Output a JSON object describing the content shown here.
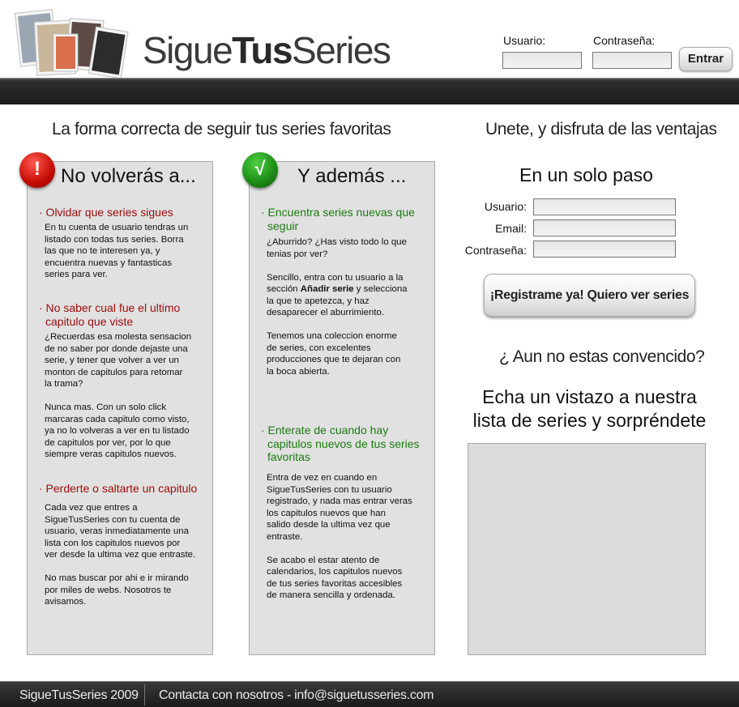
{
  "header": {
    "logo_part1": "Sigue",
    "logo_part2": "Tus",
    "logo_part3": "Series",
    "login": {
      "user_label": "Usuario:",
      "password_label": "Contraseña:",
      "user_value": "",
      "password_value": "",
      "enter_label": "Entrar"
    }
  },
  "left_tagline": "La forma correcta de seguir tus series favoritas",
  "right_tagline": "Unete, y disfruta de las ventajas",
  "col1": {
    "badge": "!",
    "title": "No volverás a...",
    "items": [
      {
        "head": [
          "· Olvidar que series sigues"
        ],
        "body": [
          "En tu cuenta de usuario tendras un",
          "listado con todas tus series. Borra",
          "las que no te interesen ya, y",
          "encuentra nuevas y fantasticas",
          "series para ver."
        ]
      },
      {
        "head": [
          "· No saber cual fue el ultimo",
          "capitulo que viste"
        ],
        "body": [
          "¿Recuerdas esa molesta sensacion",
          "de no saber por donde dejaste una",
          "serie, y tener que volver a ver un",
          "monton de capitulos para retomar",
          "la trama?",
          "",
          "Nunca mas. Con un solo click",
          "marcaras cada capitulo como visto,",
          "ya no lo volveras a ver en tu listado",
          "de capitulos por ver, por lo que",
          "siempre veras capitulos nuevos."
        ]
      },
      {
        "head": [
          "· Perderte o saltarte un capitulo"
        ],
        "body": [
          "Cada vez que entres a",
          "SigueTusSeries con tu cuenta de",
          "usuario, veras inmediatamente una",
          "lista con los capitulos nuevos por",
          "ver desde la ultima vez que entraste.",
          "",
          "No mas buscar por ahi e ir mirando",
          "por miles de webs. Nosotros te",
          "avisamos."
        ]
      }
    ]
  },
  "col2": {
    "badge": "√",
    "title": "Y además ...",
    "items": [
      {
        "head": [
          "· Encuentra series nuevas que",
          "seguir"
        ],
        "body_a": [
          "¿Aburrido? ¿Has visto todo lo que",
          "tenias por ver?",
          "",
          "Sencillo, entra con tu usuario a la"
        ],
        "body_b_pre": "sección ",
        "body_b_bold": "Añadir serie",
        "body_b_post": " y selecciona",
        "body_c": [
          "la que te apetezca, y haz",
          "desaparecer el aburrimiento.",
          "",
          "Tenemos una coleccion enorme",
          "de series, con excelentes",
          "producciones que te dejaran con",
          "la boca abierta."
        ]
      },
      {
        "head": [
          "· Enterate de cuando hay",
          "capitulos nuevos de tus series",
          "favoritas"
        ],
        "body": [
          "Entra de vez en cuando en",
          "SigueTusSeries con tu usuario",
          "registrado, y nada mas entrar veras",
          "los capitulos nuevos que han",
          "salido desde la ultima vez que",
          "entraste.",
          "",
          "Se acabo el estar atento de",
          "calendarios, los capitulos nuevos",
          "de tus series favoritas accesibles",
          "de manera sencilla y ordenada."
        ]
      }
    ]
  },
  "register": {
    "heading": "En un solo paso",
    "user_label": "Usuario:",
    "email_label": "Email:",
    "password_label": "Contraseña:",
    "button_label": "¡Registrame ya! Quiero ver series",
    "not_convinced": "¿ Aun no estas convencido?",
    "cta_line1": "Echa un vistazo a nuestra",
    "cta_line2": "lista de series y sorpréndete"
  },
  "footer": {
    "copyright": "SigueTusSeries 2009",
    "contact": "Contacta con nosotros - info@siguetusseries.com"
  }
}
